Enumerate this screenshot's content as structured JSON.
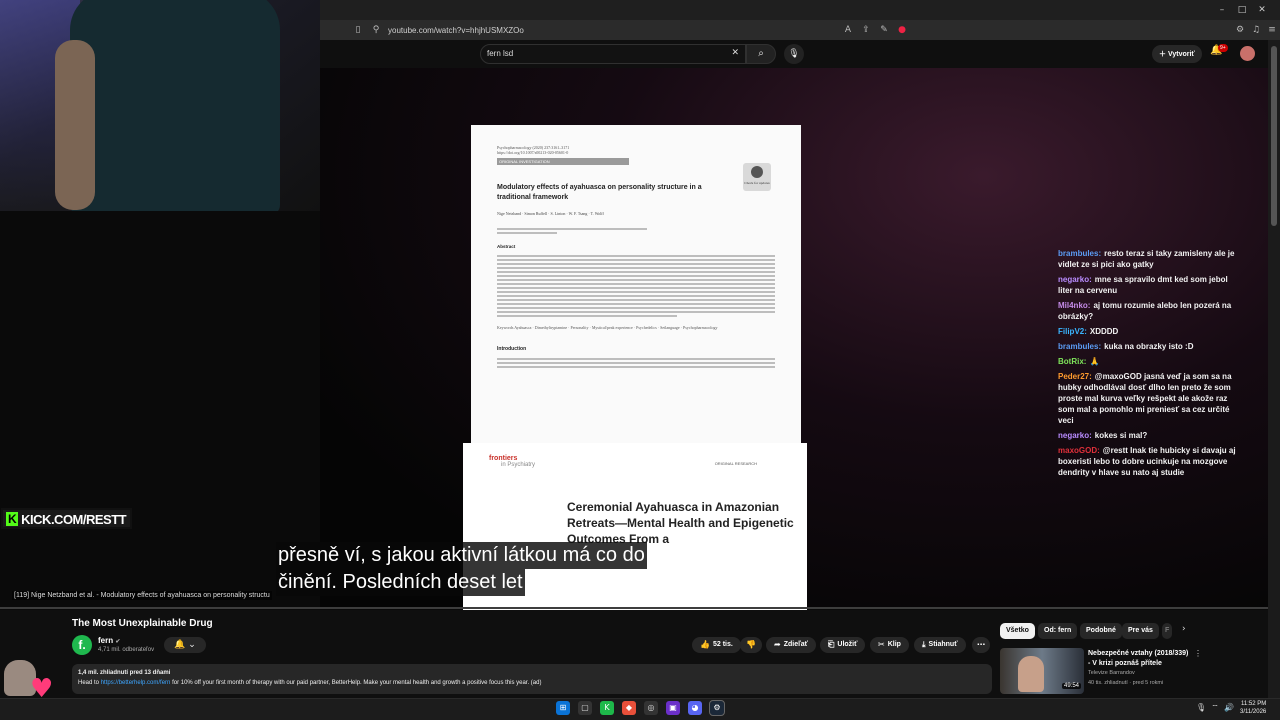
{
  "browser": {
    "url": "youtube.com/watch?v=hhjhUSMXZOo",
    "window_controls": {
      "minimize": "–",
      "maximize": "□",
      "close": "✕"
    }
  },
  "youtube": {
    "search_query": "fern lsd",
    "create_label": "Vytvoriť",
    "notif_count": "9+"
  },
  "overlay": {
    "kick_url": "KICK.COM/RESTT",
    "subtitle_lines": [
      "přesně ví, s jakou aktivní látkou má co do",
      "činění.  Posledních deset let"
    ],
    "chapter_text": "[119] Nige Netzband et al. - Modulatory effects of ayahuasca on personality structu"
  },
  "papers": {
    "paper1": {
      "journal": "Psychopharmacology (2020) 237:3161–3171",
      "doi": "https://doi.org/10.1007/s00213-020-05601-0",
      "tag": "ORIGINAL INVESTIGATION",
      "title": "Modulatory effects of ayahuasca on personality structure in a traditional framework",
      "authors": "Nige Netzband · Simon Ruffell · S. Linton · W. F. Tsang · T. Wolff",
      "check_label": "Check for updates",
      "abstract_label": "Abstract",
      "keywords": "Keywords  Ayahuasca · Dimethyltryptamine · Personality · Mystical/peak experience · Psychedelics · Setlanguage · Psychopharmacology",
      "intro_label": "Introduction"
    },
    "paper2": {
      "publisher": "frontiers",
      "publisher_sub": "in Psychiatry",
      "section": "ORIGINAL RESEARCH",
      "title": "Ceremonial Ayahuasca in Amazonian Retreats—Mental Health and Epigenetic Outcomes From a"
    }
  },
  "chat": [
    {
      "user": "brambules:",
      "color": "#5b9cf5",
      "text": "resto teraz si taky zamisleny ale je vidlet ze si pici ako gatky"
    },
    {
      "user": "negarko:",
      "color": "#b98cff",
      "text": "mne sa spravilo dmt ked som jebol liter na cervenu"
    },
    {
      "user": "Mil4nko:",
      "color": "#c58be8",
      "text": "aj tomu rozumie alebo len pozerá na obrázky?"
    },
    {
      "user": "FilipV2:",
      "color": "#3ab5ff",
      "text": "XDDDD"
    },
    {
      "user": "brambules:",
      "color": "#5b9cf5",
      "text": "kuka na obrazky isto :D"
    },
    {
      "user": "BotRix:",
      "color": "#7ee35a",
      "text": "🙏"
    },
    {
      "user": "Peder27:",
      "color": "#ff9a2e",
      "text": "@maxoGOD jasná veď ja som sa na hubky odhodlával dosť dlho len preto že som proste mal kurva veľky rešpekt ale akože raz som mal a pomohlo mi preniesť sa cez určité veci"
    },
    {
      "user": "negarko:",
      "color": "#b98cff",
      "text": "kokes si mal?"
    },
    {
      "user": "maxoGOD:",
      "color": "#e0303a",
      "text": "@restt Inak tie hubicky si davaju aj boxeristi lebo to dobre ucinkuje na mozgove dendrity v hlave su nato aj studie"
    }
  ],
  "video": {
    "title": "The Most Unexplainable Drug",
    "channel": "fern",
    "channel_initial": "f.",
    "subscribers": "4,71 mil. odberateľov",
    "likes": "52 tis.",
    "share": "Zdieľať",
    "save": "Uložiť",
    "clip": "Klip",
    "download": "Stiahnuť",
    "views_date": "1,4 mil. zhliadnutí  pred 13 dňami",
    "desc_prefix": "Head to",
    "desc_link": "https://betterhelp.com/fern",
    "desc_suffix": "for 10% off your first month of therapy with our paid partner, BetterHelp. Make your mental health and growth a positive focus this year. (ad)"
  },
  "chips": [
    "Všetko",
    "Od: fern",
    "Podobné",
    "Pre vás",
    "F"
  ],
  "recommended": {
    "title": "Nebezpečné vztahy (2018/339) - V krizi poznáš přítele",
    "channel": "Televize Barrandov",
    "meta": "40 tis. zhliadnutí · pred 5 rokmi",
    "duration": "49:54"
  },
  "taskbar": {
    "time": "11:52 PM",
    "date": "3/11/2026"
  },
  "colors": {
    "kick_green": "#53fc18",
    "yt_red": "#cc0000",
    "link_blue": "#3ea6ff"
  }
}
